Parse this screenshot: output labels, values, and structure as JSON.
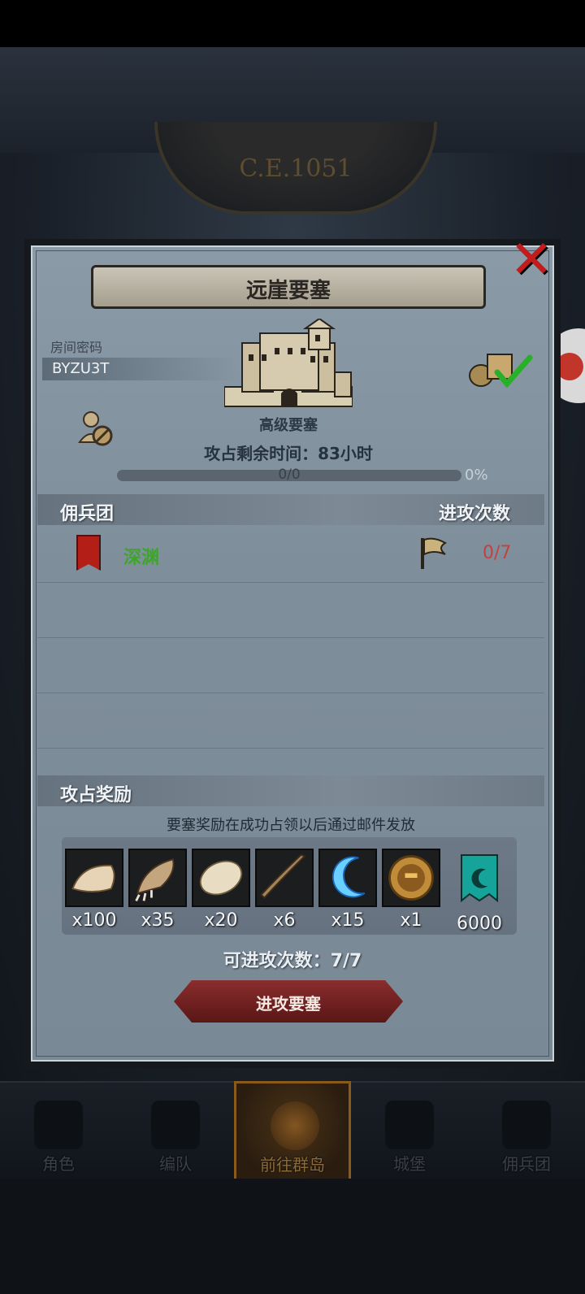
{
  "scene": {
    "era": "C.E.1051"
  },
  "dialog": {
    "title": "远崖要塞",
    "room_code_label": "房间密码",
    "room_code": "BYZU3T",
    "fort_level": "高级要塞",
    "remaining_time": "攻占剩余时间：83小时",
    "progress_text": "0/0",
    "progress_percent": "0%",
    "progress_value": 0
  },
  "mercenary_section": {
    "header_left": "佣兵团",
    "header_right": "进攻次数",
    "rows": [
      {
        "name": "深渊",
        "attacks": "0/7",
        "name_color": "#3ea52c",
        "attacks_color": "#c24141"
      }
    ]
  },
  "reward_section": {
    "header": "攻占奖励",
    "note": "要塞奖励在成功占领以后通过邮件发放",
    "items": [
      {
        "icon": "fur-pelt-icon",
        "count": "x100"
      },
      {
        "icon": "claw-icon",
        "count": "x35"
      },
      {
        "icon": "hide-icon",
        "count": "x20"
      },
      {
        "icon": "horn-icon",
        "count": "x6"
      },
      {
        "icon": "crescent-blade-icon",
        "count": "x15"
      },
      {
        "icon": "knight-medal-icon",
        "count": "x1"
      },
      {
        "icon": "guild-banner-icon",
        "count": "6000"
      }
    ]
  },
  "footer": {
    "available_attacks": "可进攻次数：7/7",
    "attack_button": "进攻要塞"
  },
  "bottom_nav": [
    {
      "label": "角色",
      "active": false
    },
    {
      "label": "编队",
      "active": false
    },
    {
      "label": "前往群岛",
      "active": true
    },
    {
      "label": "城堡",
      "active": false
    },
    {
      "label": "佣兵团",
      "active": false
    }
  ]
}
